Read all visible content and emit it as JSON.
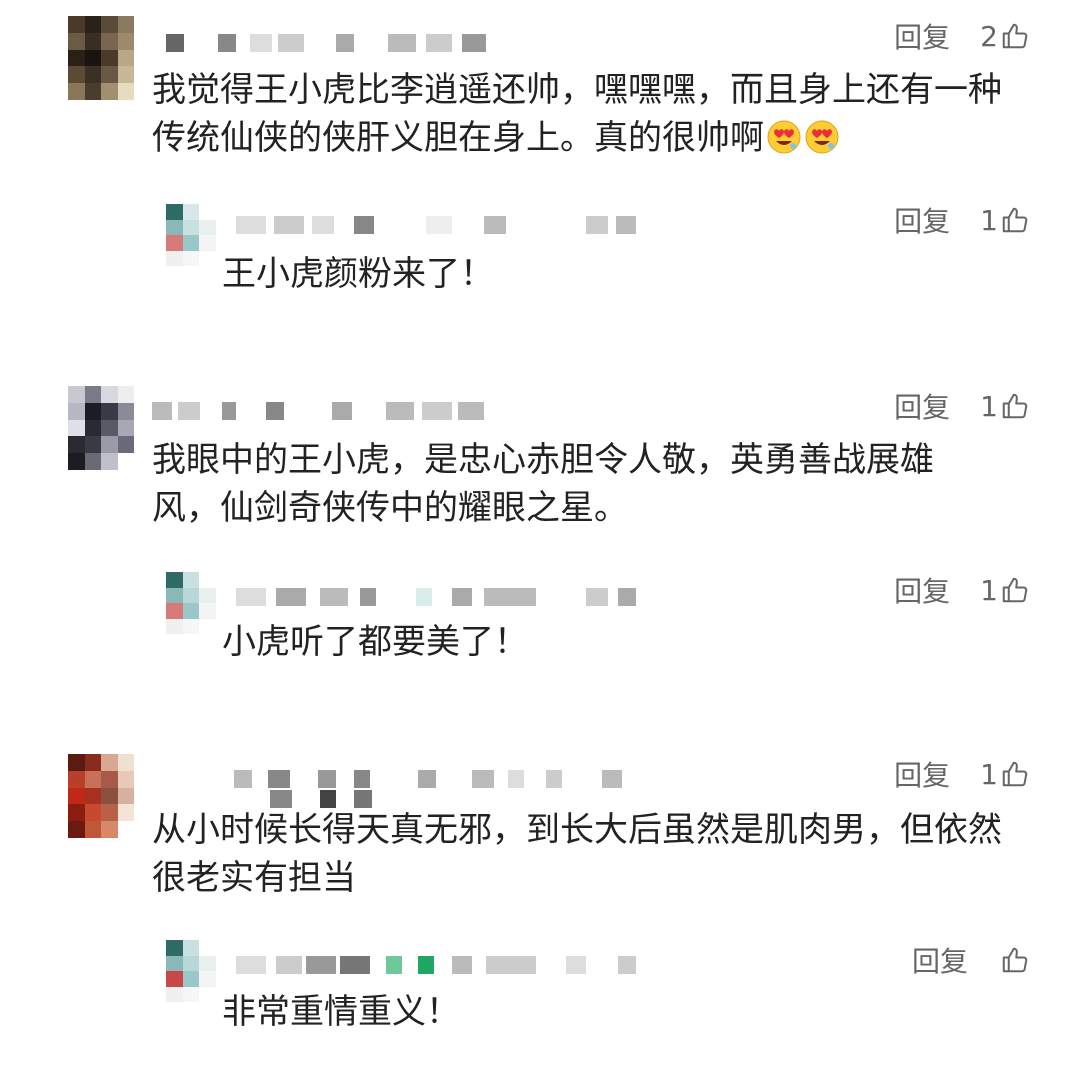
{
  "ui": {
    "reply_label": "回复",
    "colors": {
      "text": "#222222",
      "meta": "#666666",
      "background": "#ffffff"
    }
  },
  "comments": [
    {
      "text": "我觉得王小虎比李逍遥还帅，嘿嘿嘿，而且身上还有一种传统仙侠的侠肝义胆在身上。真的很帅啊",
      "likes": "2",
      "emoji": [
        "heart-eyes-emoji",
        "heart-eyes-emoji"
      ],
      "reply": {
        "text": "王小虎颜粉来了！",
        "likes": "1"
      }
    },
    {
      "text": "我眼中的王小虎，是忠心赤胆令人敬，英勇善战展雄风，仙剑奇侠传中的耀眼之星。",
      "likes": "1",
      "reply": {
        "text": "小虎听了都要美了！",
        "likes": "1"
      }
    },
    {
      "text": "从小时候长得天真无邪，到长大后虽然是肌肉男，但依然很老实有担当",
      "likes": "1",
      "reply": {
        "text": "非常重情重义！",
        "likes": ""
      }
    }
  ]
}
